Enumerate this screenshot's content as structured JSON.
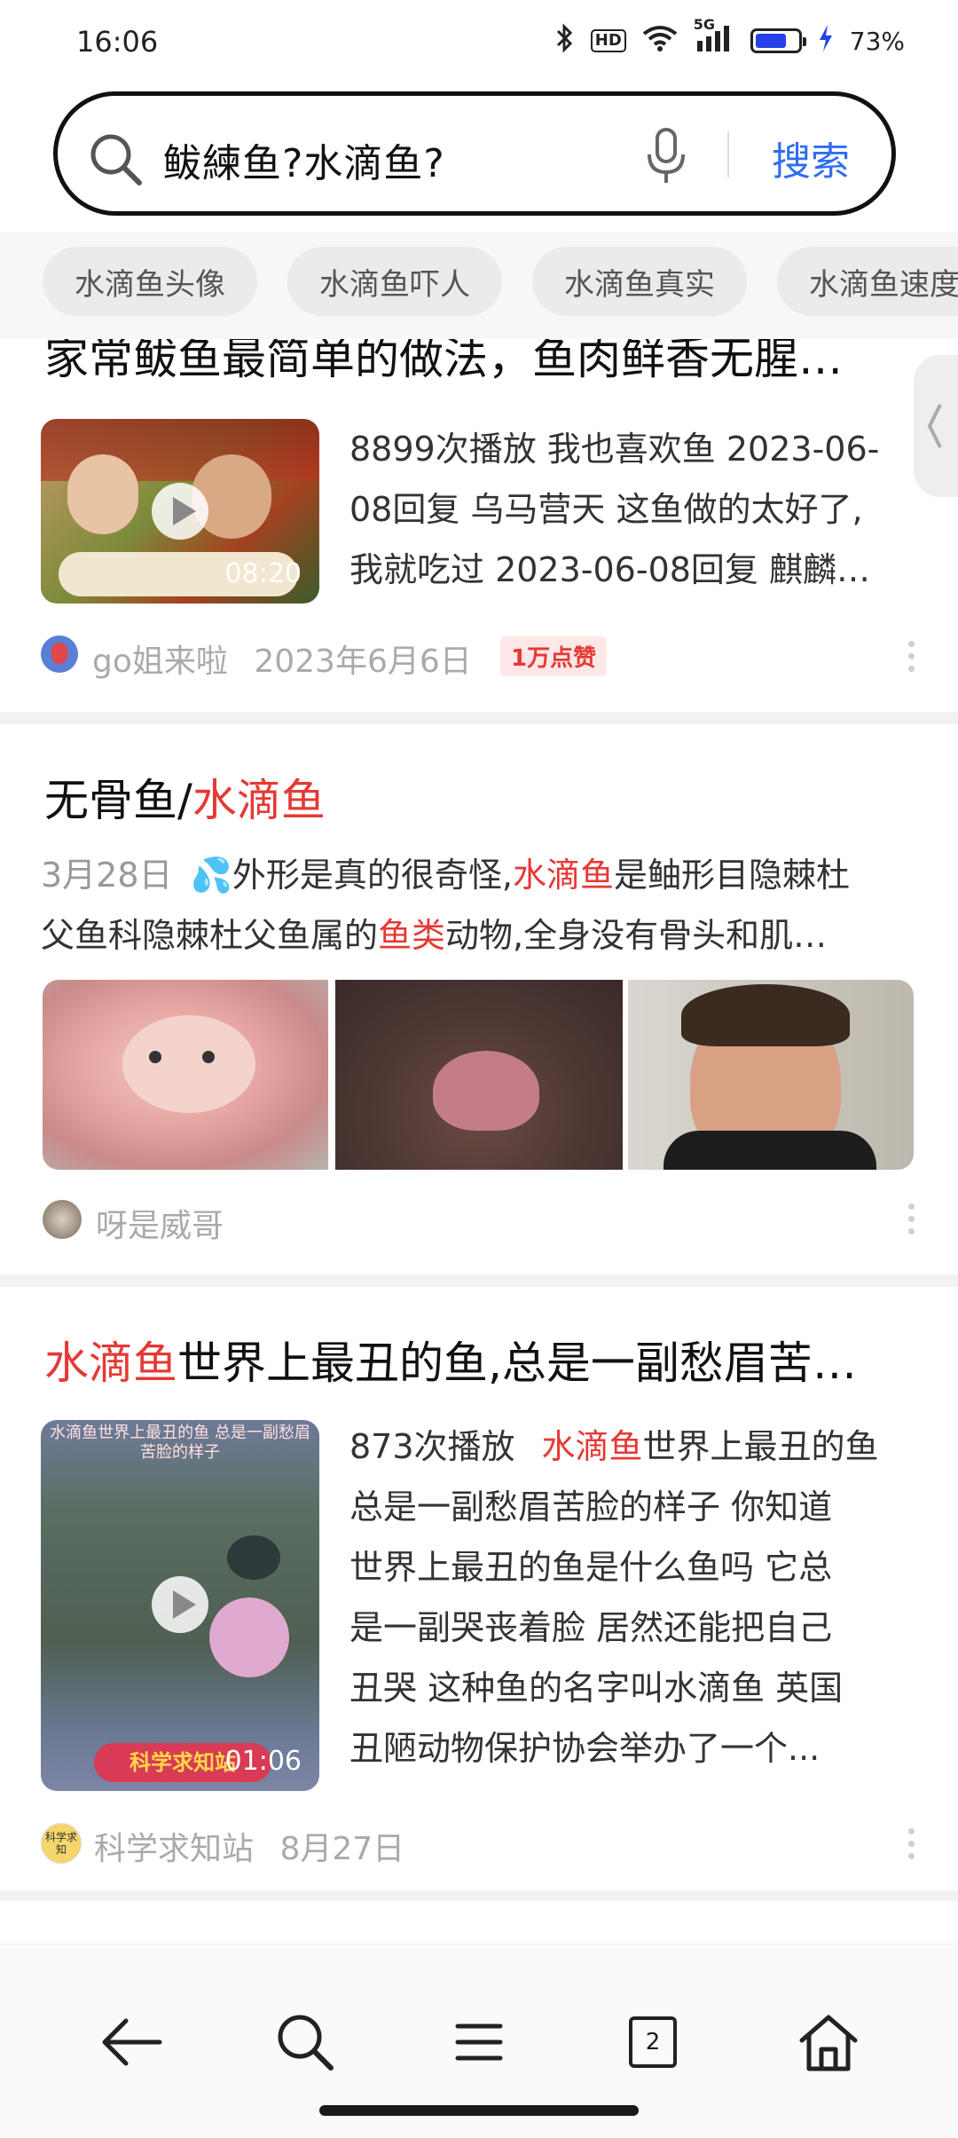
{
  "status_bar": {
    "time": "16:06",
    "hd": "HD",
    "network": "5G",
    "battery_level": 0.73,
    "battery_text": "73%"
  },
  "search": {
    "query": "鲅練鱼?水滴鱼?",
    "button": "搜索"
  },
  "chips": [
    "水滴鱼头像",
    "水滴鱼吓人",
    "水滴鱼真实",
    "水滴鱼速度"
  ],
  "results": [
    {
      "title": "家常鲅鱼最简单的做法，鱼肉鲜香无腥…",
      "description": "8899次播放 我也喜欢鱼 2023-06-08回复 乌马营天 这鱼做的太好了,我就吃过 2023-06-08回复 麒麟…",
      "desc_lines": [
        "8899次播放 我也喜欢鱼 2023-06-",
        "08回复 乌马营天 这鱼做的太好了,",
        "我就吃过 2023-06-08回复 麒麟…"
      ],
      "duration": "08:20",
      "author": "go姐来啦",
      "date": "2023年6月6日",
      "likes": "1万点赞"
    },
    {
      "title_prefix": "无骨鱼/",
      "title_highlight": "水滴鱼",
      "date": "3月28日",
      "desc_line1_a": "💦外形是真的很奇怪,",
      "desc_line1_hl": "水滴鱼",
      "desc_line1_b": "是鲉形目隐棘杜",
      "desc_line2_a": "父鱼科隐棘杜父鱼属的",
      "desc_line2_hl": "鱼类",
      "desc_line2_b": "动物,全身没有骨头和肌…",
      "author": "呀是威哥"
    },
    {
      "title_highlight": "水滴鱼",
      "title_rest": "世界上最丑的鱼,总是一副愁眉苦…",
      "plays": "873次播放",
      "desc_hl": "水滴鱼",
      "desc_line1_rest": "世界上最丑的鱼",
      "desc_lines": [
        "总是一副愁眉苦脸的样子 你知道",
        "世界上最丑的鱼是什么鱼吗 它总",
        "是一副哭丧着脸 居然还能把自己",
        "丑哭 这种鱼的名字叫水滴鱼 英国",
        "丑陋动物保护协会举办了一个..."
      ],
      "thumb_caption_top": "水滴鱼世界上最丑的鱼 总是一副愁眉苦脸的样子",
      "thumb_caption_bottom": "科学求知站",
      "duration": "01:06",
      "author": "科学求知站",
      "author_avatar_text": "科学求知",
      "date": "8月27日"
    }
  ],
  "nav": {
    "tab_count": "2"
  }
}
